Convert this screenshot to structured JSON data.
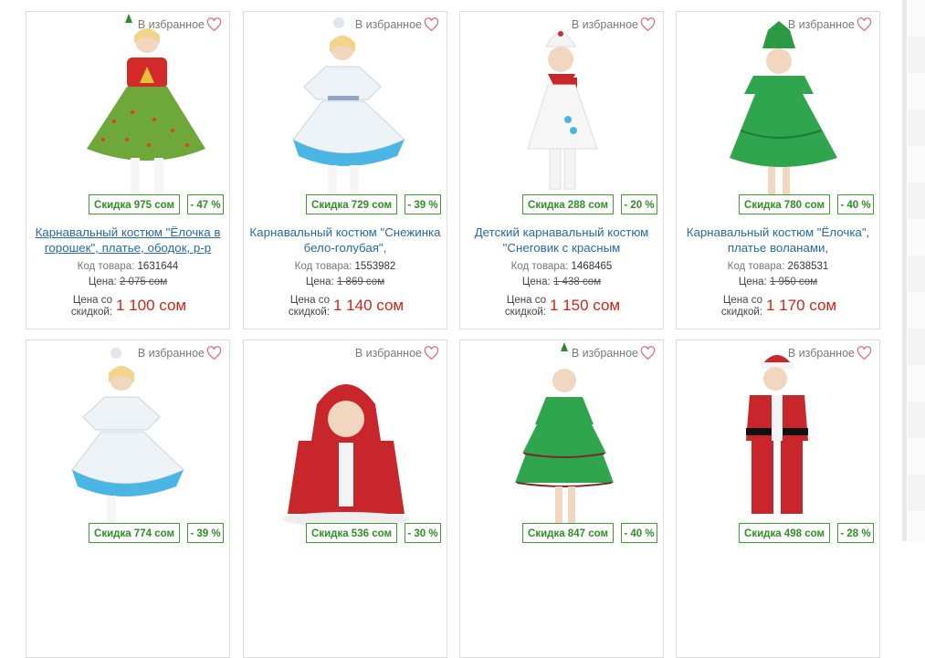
{
  "favorites_label": "В избранное",
  "code_label": "Код товара:",
  "price_label": "Цена:",
  "sale_label_1": "Цена со",
  "sale_label_2": "скидкой:",
  "colors": {
    "badge": "#3f9d31",
    "price": "#d42418",
    "link": "#2868a7"
  },
  "products": [
    {
      "title": "Карнавальный костюм \"Ёлочка в горошек\", платье, ободок, р-р",
      "discount": "Скидка 975 сом",
      "percent": "- 47 %",
      "code": "1631644",
      "old_price": "2 075 сом",
      "new_price": "1 100 сом",
      "image_icon": "girl-costume-green-dots"
    },
    {
      "title": "Карнавальный костюм \"Снежинка бело-голубая\",",
      "discount": "Скидка 729 сом",
      "percent": "- 39 %",
      "code": "1553982",
      "old_price": "1 869 сом",
      "new_price": "1 140 сом",
      "image_icon": "girl-costume-snowflake"
    },
    {
      "title": "Детский карнавальный костюм \"Снеговик с красным",
      "discount": "Скидка 288 сом",
      "percent": "- 20 %",
      "code": "1468465",
      "old_price": "1 438 сом",
      "new_price": "1 150 сом",
      "image_icon": "child-costume-snowman"
    },
    {
      "title": "Карнавальный костюм \"Ёлочка\", платье воланами,",
      "discount": "Скидка 780 сом",
      "percent": "- 40 %",
      "code": "2638531",
      "old_price": "1 950 сом",
      "new_price": "1 170 сом",
      "image_icon": "girl-costume-green-kokoshnik"
    },
    {
      "title": "",
      "discount": "Скидка 774 сом",
      "percent": "- 39 %",
      "code": "",
      "old_price": "",
      "new_price": "",
      "image_icon": "girl-costume-snowflake"
    },
    {
      "title": "",
      "discount": "Скидка 536 сом",
      "percent": "- 30 %",
      "code": "",
      "old_price": "",
      "new_price": "",
      "image_icon": "baby-costume-red-hood"
    },
    {
      "title": "",
      "discount": "Скидка 847 сом",
      "percent": "- 40 %",
      "code": "",
      "old_price": "",
      "new_price": "",
      "image_icon": "girl-costume-christmas-tree"
    },
    {
      "title": "",
      "discount": "Скидка 498 сом",
      "percent": "- 28 %",
      "code": "",
      "old_price": "",
      "new_price": "",
      "image_icon": "boy-costume-santa"
    }
  ]
}
